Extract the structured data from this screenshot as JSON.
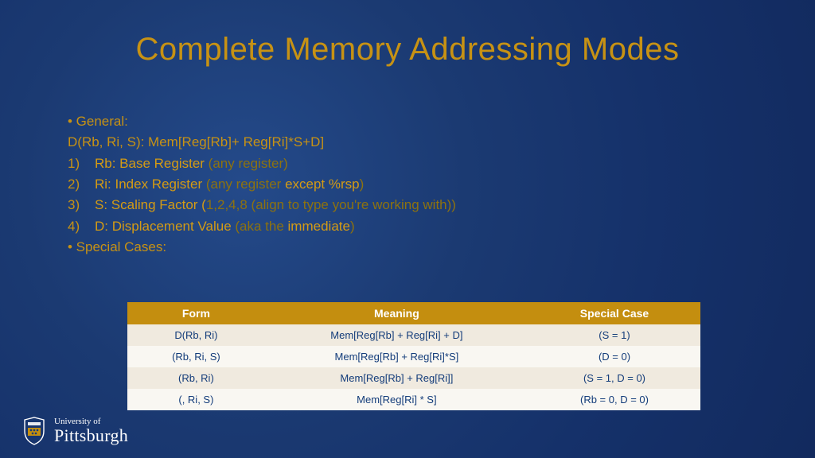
{
  "title": "Complete Memory Addressing Modes",
  "bullets": {
    "general_label": "• General:",
    "formula": "D(Rb, Ri, S): Mem[Reg[Rb]+ Reg[Ri]*S+D]",
    "items": [
      {
        "term": "Rb: Base Register",
        "note_pre": " (any register)",
        "note_em": "",
        "note_post": ""
      },
      {
        "term": "Ri: Index Register",
        "note_pre": " (any register ",
        "note_em": "except %rsp",
        "note_post": ")"
      },
      {
        "term": "S: Scaling Factor (",
        "note_pre": "1,2,4,8 (align to type you're working with))",
        "note_em": "",
        "note_post": ""
      },
      {
        "term": "D: Displacement Value",
        "note_pre": " (aka the ",
        "note_em": "immediate",
        "note_post": ")"
      }
    ],
    "special_label": "• Special Cases:"
  },
  "table": {
    "headers": [
      "Form",
      "Meaning",
      "Special Case"
    ],
    "rows": [
      {
        "form": "D(Rb, Ri)",
        "meaning": "Mem[Reg[Rb] + Reg[Ri] + D]",
        "case": "(S = 1)"
      },
      {
        "form": "(Rb, Ri, S)",
        "meaning": "Mem[Reg[Rb] + Reg[Ri]*S]",
        "case": "(D = 0)"
      },
      {
        "form": "(Rb, Ri)",
        "meaning": "Mem[Reg[Rb] + Reg[Ri]]",
        "case": "(S = 1, D = 0)"
      },
      {
        "form": "(, Ri, S)",
        "meaning": "Mem[Reg[Ri] * S]",
        "case": "(Rb = 0, D = 0)"
      }
    ]
  },
  "footer": {
    "line1": "University of",
    "line2": "Pittsburgh"
  }
}
